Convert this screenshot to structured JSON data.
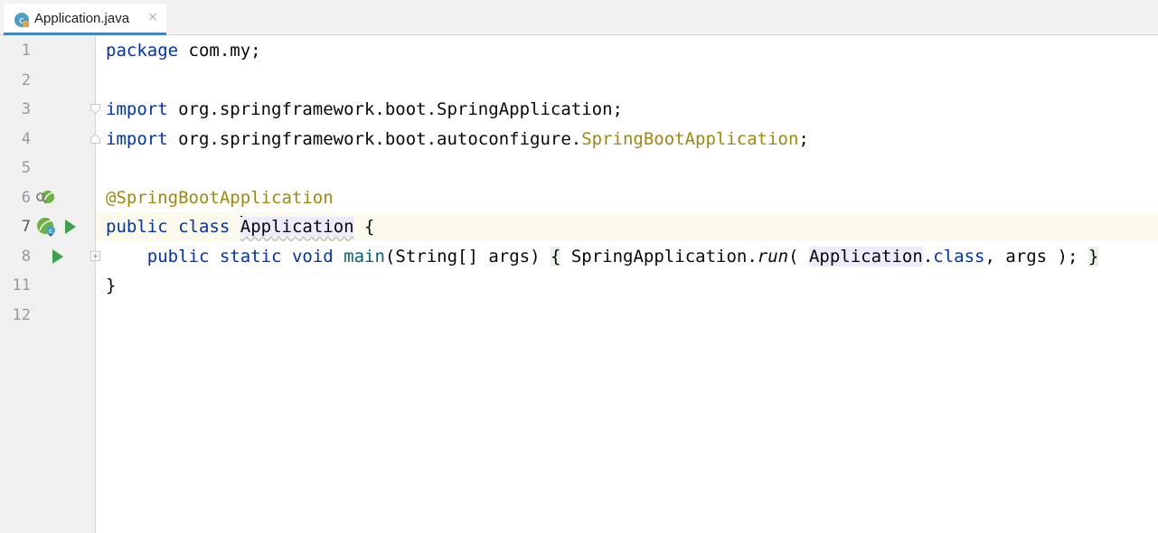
{
  "tab": {
    "label": "Application.java",
    "close": "×"
  },
  "lines": [
    {
      "num": "1"
    },
    {
      "num": "2"
    },
    {
      "num": "3"
    },
    {
      "num": "4"
    },
    {
      "num": "5"
    },
    {
      "num": "6"
    },
    {
      "num": "7"
    },
    {
      "num": "8"
    },
    {
      "num": "11"
    },
    {
      "num": "12"
    }
  ],
  "code": {
    "l1": {
      "kw": "package",
      "rest": " com.my;"
    },
    "l3": {
      "kw": "import",
      "rest": " org.springframework.boot.SpringApplication;"
    },
    "l4": {
      "kw": "import",
      "rest": " org.springframework.boot.autoconfigure.",
      "ann": "SpringBootApplication",
      "end": ";"
    },
    "l6": {
      "ann": "@SpringBootApplication"
    },
    "l7": {
      "kw1": "public",
      "kw2": "class",
      "name": "Application",
      "end": " {"
    },
    "l8": {
      "kw1": "public",
      "kw2": "static",
      "kw3": "void",
      "fn": "main",
      "sig": "(String[] args) ",
      "ob": "{",
      "call": " SpringApplication.",
      "run": "run",
      "p1": "( ",
      "cls": "Application",
      "dot": ".",
      "kwclass": "class",
      "p2": ", args ); ",
      "cb": "}"
    },
    "l11": {
      "end": "}"
    }
  },
  "colors": {
    "keyword": "#0033b3",
    "annotation": "#9e880d",
    "method": "#00627a",
    "accent": "#4083c9"
  }
}
